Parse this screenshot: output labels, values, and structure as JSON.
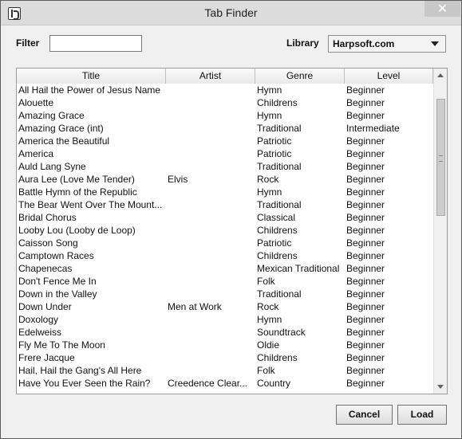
{
  "window": {
    "title": "Tab Finder",
    "close_symbol": "✕"
  },
  "filter": {
    "label": "Filter",
    "value": "",
    "placeholder": ""
  },
  "library": {
    "label": "Library",
    "selected": "Harpsoft.com"
  },
  "table": {
    "columns": [
      "Title",
      "Artist",
      "Genre",
      "Level"
    ],
    "rows": [
      [
        "All Hail the Power of Jesus Name",
        "",
        "Hymn",
        "Beginner"
      ],
      [
        "Alouette",
        "",
        "Childrens",
        "Beginner"
      ],
      [
        "Amazing Grace",
        "",
        "Hymn",
        "Beginner"
      ],
      [
        "Amazing Grace (int)",
        "",
        "Traditional",
        "Intermediate"
      ],
      [
        "America the Beautiful",
        "",
        "Patriotic",
        "Beginner"
      ],
      [
        "America",
        "",
        "Patriotic",
        "Beginner"
      ],
      [
        "Auld Lang Syne",
        "",
        "Traditional",
        "Beginner"
      ],
      [
        "Aura Lee (Love Me Tender)",
        "Elvis",
        "Rock",
        "Beginner"
      ],
      [
        "Battle Hymn of the Republic",
        "",
        "Hymn",
        "Beginner"
      ],
      [
        "The Bear Went Over The Mount...",
        "",
        "Traditional",
        "Beginner"
      ],
      [
        "Bridal Chorus",
        "",
        "Classical",
        "Beginner"
      ],
      [
        "Looby Lou (Looby de Loop)",
        "",
        "Childrens",
        "Beginner"
      ],
      [
        "Caisson Song",
        "",
        "Patriotic",
        "Beginner"
      ],
      [
        "Camptown Races",
        "",
        "Childrens",
        "Beginner"
      ],
      [
        "Chapenecas",
        "",
        "Mexican Traditional",
        "Beginner"
      ],
      [
        "Don't Fence Me In",
        "",
        "Folk",
        "Beginner"
      ],
      [
        "Down in the Valley",
        "",
        "Traditional",
        "Beginner"
      ],
      [
        "Down Under",
        "Men at Work",
        "Rock",
        "Beginner"
      ],
      [
        "Doxology",
        "",
        "Hymn",
        "Beginner"
      ],
      [
        "Edelweiss",
        "",
        "Soundtrack",
        "Beginner"
      ],
      [
        "Fly Me To The Moon",
        "",
        "Oldie",
        "Beginner"
      ],
      [
        "Frere Jacque",
        "",
        "Childrens",
        "Beginner"
      ],
      [
        "Hail, Hail the Gang's All Here",
        "",
        "Folk",
        "Beginner"
      ],
      [
        "Have You Ever Seen the Rain?",
        "Creedence Clear...",
        "Country",
        "Beginner"
      ]
    ]
  },
  "buttons": {
    "cancel": "Cancel",
    "load": "Load"
  }
}
